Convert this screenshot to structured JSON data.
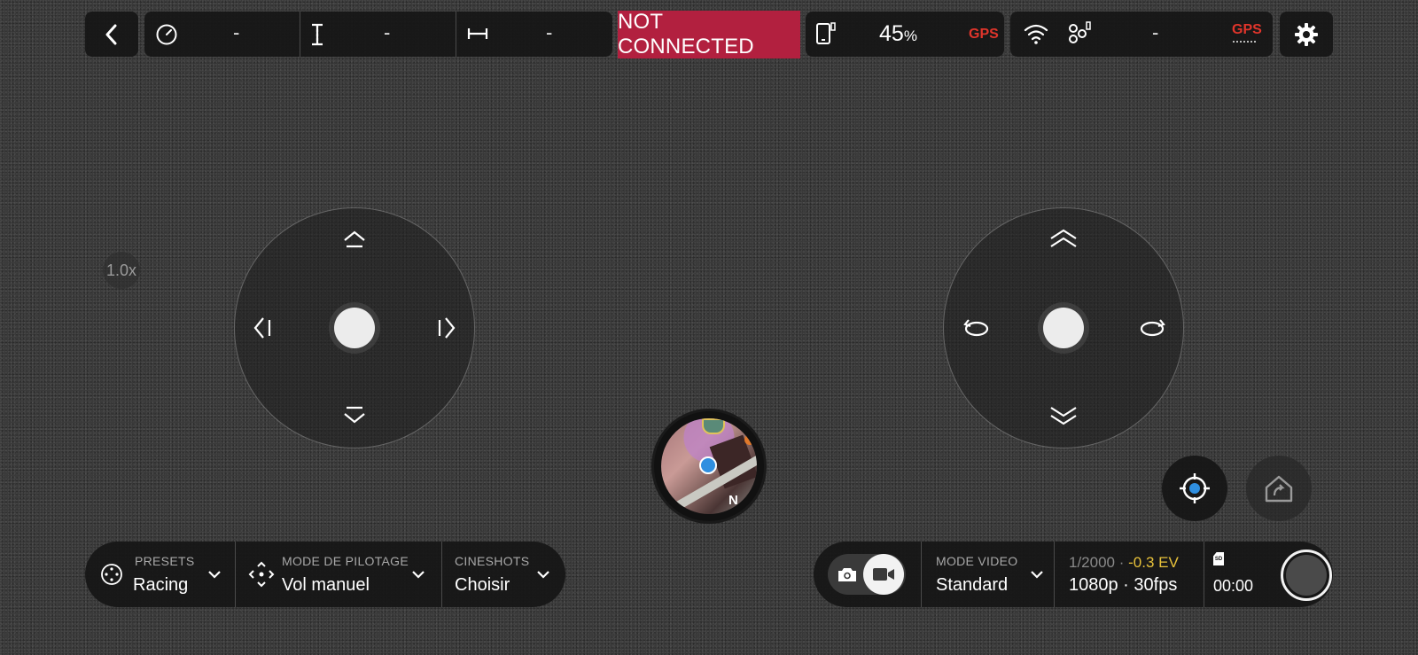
{
  "top_bar": {
    "speed_value": "-",
    "altitude_value": "-",
    "distance_value": "-",
    "connection_status": "NOT CONNECTED",
    "battery_number": "45",
    "battery_unit": "%",
    "phone_gps_label": "GPS",
    "drone_link_value": "-",
    "drone_gps_label": "GPS"
  },
  "zoom_level": "1.0x",
  "minimap": {
    "north_label": "N"
  },
  "bottom_left": {
    "presets_label": "PRESETS",
    "presets_value": "Racing",
    "piloting_label": "MODE DE PILOTAGE",
    "piloting_value": "Vol manuel",
    "cineshots_label": "CINESHOTS",
    "cineshots_value": "Choisir"
  },
  "bottom_right": {
    "video_mode_label": "MODE VIDEO",
    "video_mode_value": "Standard",
    "shutter": "1/2000",
    "separator": "·",
    "ev": "-0.3 EV",
    "resolution": "1080p · 30fps",
    "sd_label": "SD",
    "record_time": "00:00"
  },
  "colors": {
    "connection_bg": "#b2203f",
    "gps_red": "#e0352b",
    "ev_yellow": "#e8c23a",
    "location_blue": "#2f8fe0"
  },
  "icons": [
    "back-icon",
    "speedometer-icon",
    "altitude-icon",
    "distance-icon",
    "phone-icon",
    "wifi-icon",
    "drone-link-icon",
    "gear-icon",
    "presets-icon",
    "piloting-mode-icon",
    "chevron-down-icon",
    "camera-icon",
    "video-camera-icon",
    "sd-card-icon",
    "locate-icon",
    "return-home-icon"
  ]
}
